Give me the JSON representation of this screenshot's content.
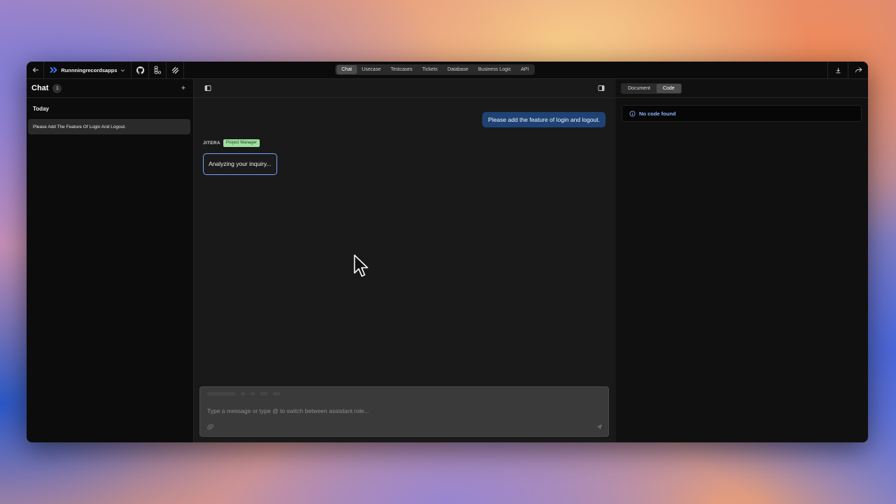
{
  "topbar": {
    "project_name": "Runnningrecordsapps",
    "tabs": [
      {
        "label": "Chat",
        "active": true
      },
      {
        "label": "Usecase",
        "active": false
      },
      {
        "label": "Testcases",
        "active": false
      },
      {
        "label": "Tickets",
        "active": false
      },
      {
        "label": "Database",
        "active": false
      },
      {
        "label": "Business Logic",
        "active": false
      },
      {
        "label": "API",
        "active": false
      }
    ],
    "icons": [
      "back-arrow-icon",
      "project-logo-icon",
      "chevron-down-icon",
      "github-icon",
      "figma-icon",
      "jira-icon",
      "download-icon",
      "share-icon"
    ]
  },
  "sidebar": {
    "title": "Chat",
    "count": "1",
    "add_label": "+",
    "group_label": "Today",
    "items": [
      {
        "label": "Please Add The Feature Of Login And Logout."
      }
    ]
  },
  "chat": {
    "user_message": "Please add the feature of login and logout.",
    "assistant_name": "JITERA",
    "assistant_role": "Project Manager",
    "assistant_message": "Analyzing your inquiry...",
    "composer_placeholder": "Type a message or type @ to switch between assistant role..."
  },
  "right_panel": {
    "segments": [
      {
        "label": "Document",
        "active": false
      },
      {
        "label": "Code",
        "active": true
      }
    ],
    "notice": "No code found"
  },
  "colors": {
    "accent_blue": "#1e4274",
    "role_badge": "#9fe0a0",
    "notice_text": "#8fb4ff"
  }
}
